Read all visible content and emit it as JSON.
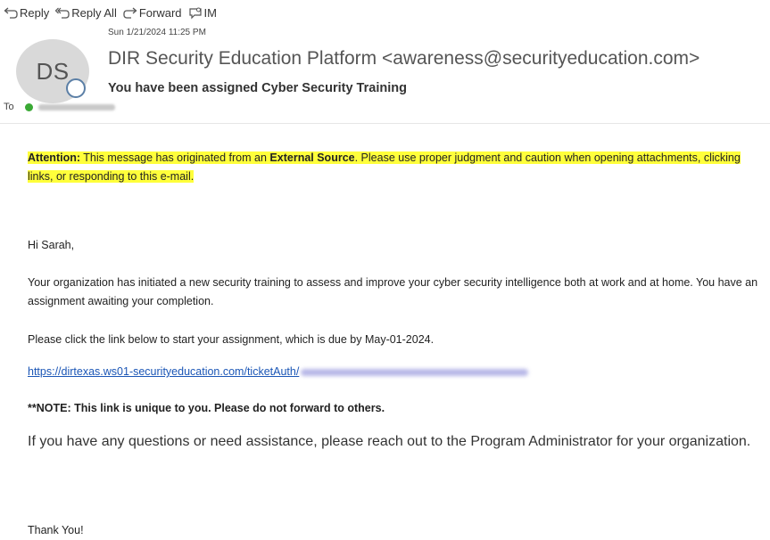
{
  "toolbar": {
    "reply": "Reply",
    "reply_all": "Reply All",
    "forward": "Forward",
    "im": "IM"
  },
  "header": {
    "date": "Sun 1/21/2024 11:25 PM",
    "avatar_initials": "DS",
    "sender": "DIR Security Education Platform <awareness@securityeducation.com>",
    "subject": "You have been assigned Cyber Security Training",
    "to_label": "To"
  },
  "body": {
    "attention_label": "Attention:",
    "attention_pre": "This message has originated from an",
    "attention_bold": "External Source",
    "attention_post": ". Please use proper judgment and caution when opening attachments, clicking links, or responding to this e-mail.",
    "greeting": "Hi Sarah,",
    "paragraph1": "Your organization has initiated a new security training to assess and improve your cyber security intelligence both at work and at home. You have an assignment awaiting your completion.",
    "paragraph2": "Please click the link below to start your assignment, which is due by May-01-2024.",
    "link": "https://dirtexas.ws01-securityeducation.com/ticketAuth/",
    "note": "**NOTE: This link is unique to you. Please do not forward to others.",
    "questions": "If you have any questions or need assistance, please reach out to the Program Administrator for your organization.",
    "signoff": "Thank You!"
  },
  "colors": {
    "highlight": "#ffff3b",
    "link": "#1b56b6",
    "avatar_bg": "#d9d9d9",
    "presence_green": "#3aa935"
  }
}
